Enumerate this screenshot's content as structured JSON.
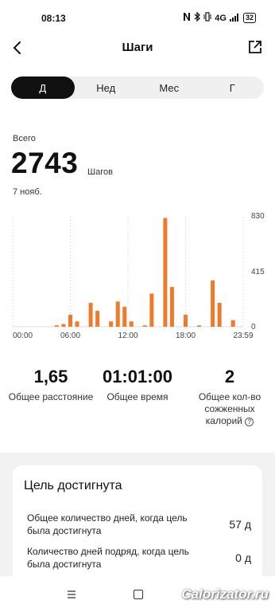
{
  "status_bar": {
    "time": "08:13",
    "signal": "4G",
    "battery": "32"
  },
  "header": {
    "title": "Шаги"
  },
  "tabs": [
    {
      "label": "Д",
      "active": true
    },
    {
      "label": "Нед",
      "active": false
    },
    {
      "label": "Мес",
      "active": false
    },
    {
      "label": "Г",
      "active": false
    }
  ],
  "summary": {
    "total_label": "Всего",
    "total_steps": "2743",
    "unit": "Шагов",
    "date": "7 нояб."
  },
  "chart_data": {
    "type": "bar",
    "color": "#f07a2a",
    "x_min": 0,
    "x_max": 24,
    "ylim": [
      0,
      830
    ],
    "y_ticks": [
      "830",
      "415",
      "0"
    ],
    "x_ticks": [
      "00:00",
      "06:00",
      "12:00",
      "18:00",
      "23:59"
    ],
    "values": [
      0,
      0,
      0,
      0,
      0,
      0,
      10,
      20,
      90,
      40,
      0,
      180,
      120,
      0,
      40,
      190,
      150,
      40,
      0,
      10,
      250,
      0,
      820,
      300,
      0,
      90,
      0,
      10,
      0,
      350,
      180,
      0,
      50,
      0
    ]
  },
  "stats": [
    {
      "value": "1,65",
      "label": "Общее расстояние",
      "info": false
    },
    {
      "value": "01:01:00",
      "label": "Общее время",
      "info": false
    },
    {
      "value": "2",
      "label": "Общее кол-во сожженных калорий",
      "info": true
    }
  ],
  "goal": {
    "title": "Цель достигнута",
    "rows": [
      {
        "label": "Общее количество дней, когда цель была достигнута",
        "value": "57 д"
      },
      {
        "label": "Количество дней подряд, когда цель была достигнута",
        "value": "0 д"
      }
    ]
  },
  "watermark": "Calorizator.ru"
}
